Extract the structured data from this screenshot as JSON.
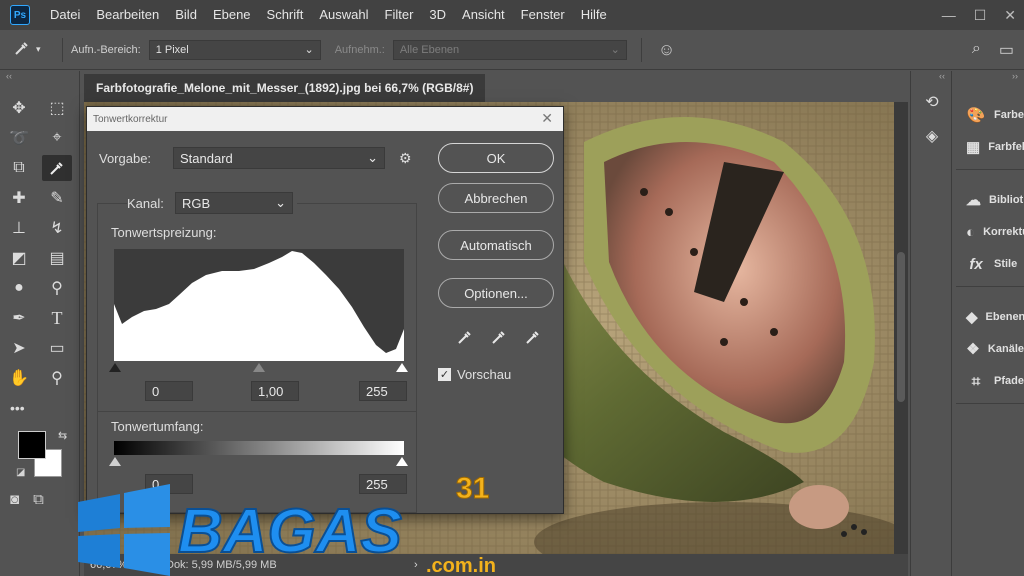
{
  "menubar": {
    "logo": "Ps",
    "items": [
      "Datei",
      "Bearbeiten",
      "Bild",
      "Ebene",
      "Schrift",
      "Auswahl",
      "Filter",
      "3D",
      "Ansicht",
      "Fenster",
      "Hilfe"
    ],
    "window_controls": [
      "—",
      "☐",
      "✕"
    ]
  },
  "options": {
    "sample_area_label": "Aufn.-Bereich:",
    "sample_area_value": "1 Pixel",
    "sample_layers_label": "Aufnehm.:",
    "sample_layers_value": "Alle Ebenen"
  },
  "document": {
    "tab_title": "Farbfotografie_Melone_mit_Messer_(1892).jpg bei 66,7% (RGB/8#)"
  },
  "status": {
    "zoom": "66,67%",
    "doc_size": "Dok: 5,99 MB/5,99 MB"
  },
  "right_panel": {
    "items": [
      {
        "label": "Farbe",
        "icon": "palette-icon"
      },
      {
        "label": "Farbfelder",
        "icon": "swatches-icon"
      },
      {
        "label": "Bibliotheken",
        "icon": "libraries-icon"
      },
      {
        "label": "Korrekturen",
        "icon": "adjustments-icon"
      },
      {
        "label": "Stile",
        "icon": "styles-icon"
      },
      {
        "label": "Ebenen",
        "icon": "layers-icon"
      },
      {
        "label": "Kanäle",
        "icon": "channels-icon"
      },
      {
        "label": "Pfade",
        "icon": "paths-icon"
      }
    ]
  },
  "dialog": {
    "title": "Tonwertkorrektur",
    "preset_label": "Vorgabe:",
    "preset_value": "Standard",
    "channel_label": "Kanal:",
    "channel_value": "RGB",
    "input_levels_label": "Tonwertspreizung:",
    "input_black": "0",
    "input_gamma": "1,00",
    "input_white": "255",
    "output_levels_label": "Tonwertumfang:",
    "output_black": "0",
    "output_white": "255",
    "buttons": {
      "ok": "OK",
      "cancel": "Abbrechen",
      "auto": "Automatisch",
      "options": "Optionen..."
    },
    "preview_label": "Vorschau",
    "preview_checked": true
  },
  "watermark": {
    "brand": "BAGAS",
    "number": "31",
    "domain": ".com.in"
  }
}
